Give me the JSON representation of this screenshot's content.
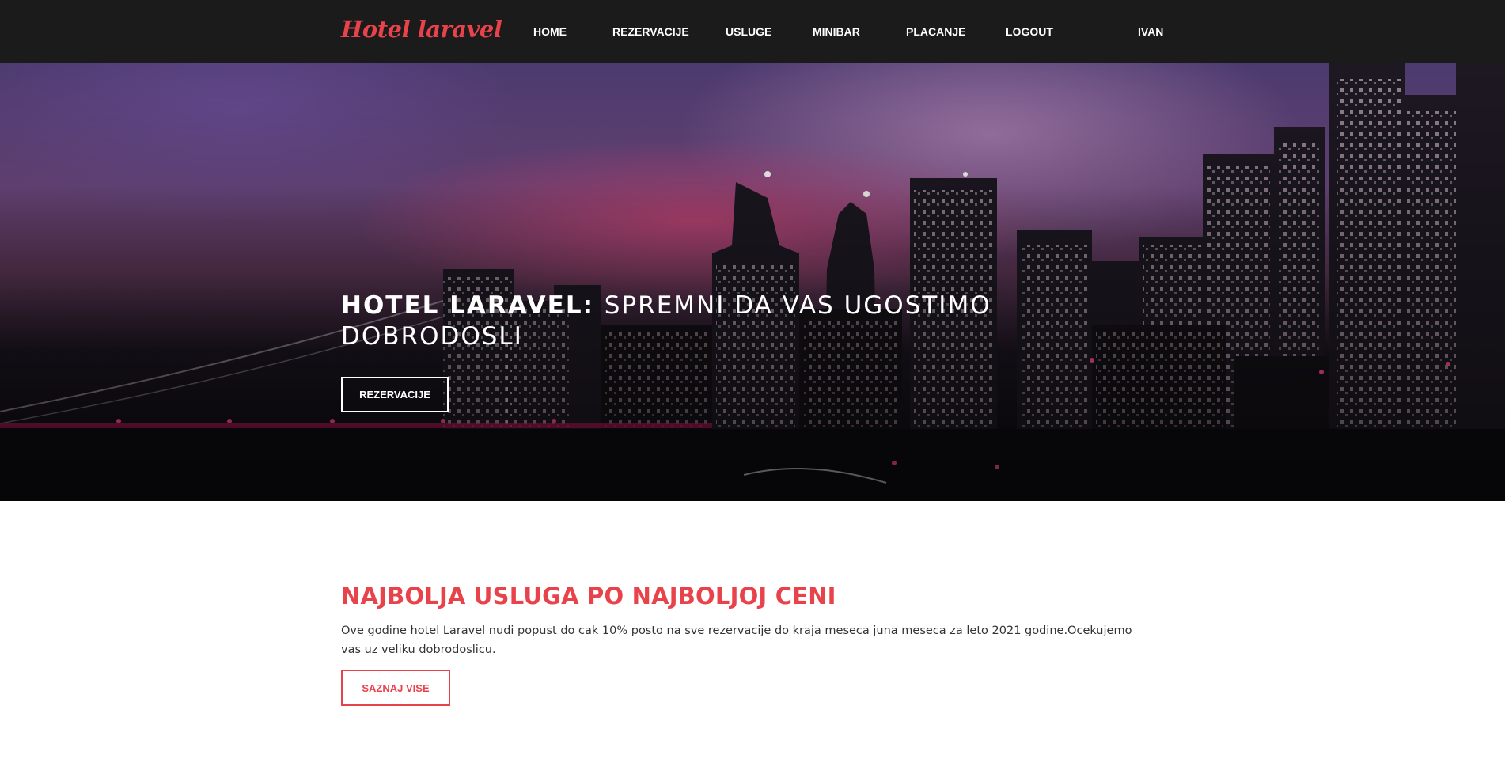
{
  "brand": {
    "logo_text": "Hotel laravel",
    "accent_color": "#e8434b",
    "nav_bg": "#1b1b1b"
  },
  "nav": {
    "items": [
      {
        "label": "HOME"
      },
      {
        "label": "REZERVACIJE"
      },
      {
        "label": "USLUGE"
      },
      {
        "label": "MINIBAR"
      },
      {
        "label": "PLACANJE"
      },
      {
        "label": "LOGOUT"
      }
    ],
    "user": "IVAN"
  },
  "hero": {
    "title_strong": "HOTEL LARAVEL:",
    "title_light": "SPREMNI DA VAS UGOSTIMO DOBRODOSLI",
    "button_label": "REZERVACIJE",
    "background": "night city skyline with purple and pink sky"
  },
  "promo": {
    "title": "NAJBOLJA USLUGA PO NAJBOLJOJ CENI",
    "text": "Ove godine hotel Laravel nudi popust do cak 10% posto na sve rezervacije do kraja meseca juna meseca za leto 2021 godine.Ocekujemo vas uz veliku dobrodoslicu.",
    "button_label": "SAZNAJ VISE"
  }
}
